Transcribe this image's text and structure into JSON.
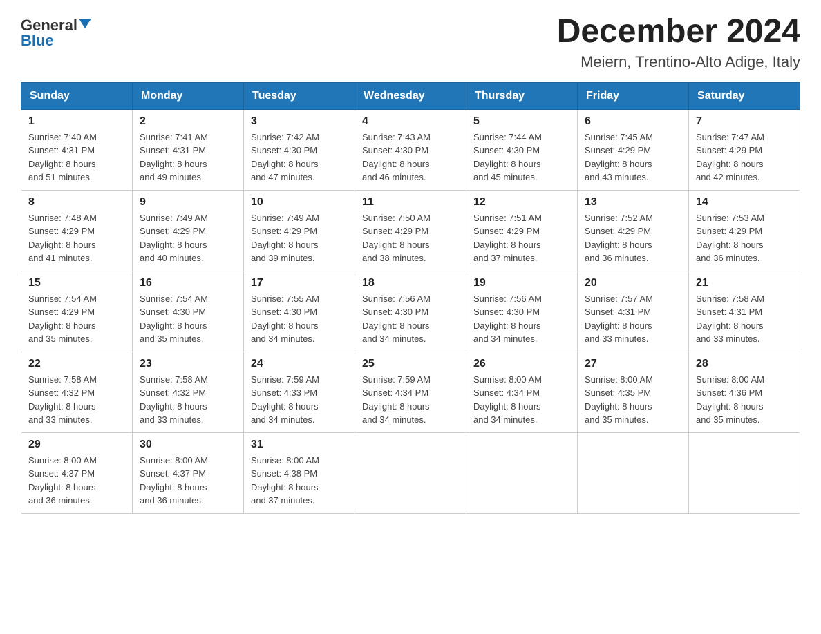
{
  "logo": {
    "general": "General",
    "blue": "Blue"
  },
  "title": "December 2024",
  "subtitle": "Meiern, Trentino-Alto Adige, Italy",
  "headers": [
    "Sunday",
    "Monday",
    "Tuesday",
    "Wednesday",
    "Thursday",
    "Friday",
    "Saturday"
  ],
  "weeks": [
    [
      {
        "num": "1",
        "sunrise": "7:40 AM",
        "sunset": "4:31 PM",
        "daylight": "8 hours and 51 minutes."
      },
      {
        "num": "2",
        "sunrise": "7:41 AM",
        "sunset": "4:31 PM",
        "daylight": "8 hours and 49 minutes."
      },
      {
        "num": "3",
        "sunrise": "7:42 AM",
        "sunset": "4:30 PM",
        "daylight": "8 hours and 47 minutes."
      },
      {
        "num": "4",
        "sunrise": "7:43 AM",
        "sunset": "4:30 PM",
        "daylight": "8 hours and 46 minutes."
      },
      {
        "num": "5",
        "sunrise": "7:44 AM",
        "sunset": "4:30 PM",
        "daylight": "8 hours and 45 minutes."
      },
      {
        "num": "6",
        "sunrise": "7:45 AM",
        "sunset": "4:29 PM",
        "daylight": "8 hours and 43 minutes."
      },
      {
        "num": "7",
        "sunrise": "7:47 AM",
        "sunset": "4:29 PM",
        "daylight": "8 hours and 42 minutes."
      }
    ],
    [
      {
        "num": "8",
        "sunrise": "7:48 AM",
        "sunset": "4:29 PM",
        "daylight": "8 hours and 41 minutes."
      },
      {
        "num": "9",
        "sunrise": "7:49 AM",
        "sunset": "4:29 PM",
        "daylight": "8 hours and 40 minutes."
      },
      {
        "num": "10",
        "sunrise": "7:49 AM",
        "sunset": "4:29 PM",
        "daylight": "8 hours and 39 minutes."
      },
      {
        "num": "11",
        "sunrise": "7:50 AM",
        "sunset": "4:29 PM",
        "daylight": "8 hours and 38 minutes."
      },
      {
        "num": "12",
        "sunrise": "7:51 AM",
        "sunset": "4:29 PM",
        "daylight": "8 hours and 37 minutes."
      },
      {
        "num": "13",
        "sunrise": "7:52 AM",
        "sunset": "4:29 PM",
        "daylight": "8 hours and 36 minutes."
      },
      {
        "num": "14",
        "sunrise": "7:53 AM",
        "sunset": "4:29 PM",
        "daylight": "8 hours and 36 minutes."
      }
    ],
    [
      {
        "num": "15",
        "sunrise": "7:54 AM",
        "sunset": "4:29 PM",
        "daylight": "8 hours and 35 minutes."
      },
      {
        "num": "16",
        "sunrise": "7:54 AM",
        "sunset": "4:30 PM",
        "daylight": "8 hours and 35 minutes."
      },
      {
        "num": "17",
        "sunrise": "7:55 AM",
        "sunset": "4:30 PM",
        "daylight": "8 hours and 34 minutes."
      },
      {
        "num": "18",
        "sunrise": "7:56 AM",
        "sunset": "4:30 PM",
        "daylight": "8 hours and 34 minutes."
      },
      {
        "num": "19",
        "sunrise": "7:56 AM",
        "sunset": "4:30 PM",
        "daylight": "8 hours and 34 minutes."
      },
      {
        "num": "20",
        "sunrise": "7:57 AM",
        "sunset": "4:31 PM",
        "daylight": "8 hours and 33 minutes."
      },
      {
        "num": "21",
        "sunrise": "7:58 AM",
        "sunset": "4:31 PM",
        "daylight": "8 hours and 33 minutes."
      }
    ],
    [
      {
        "num": "22",
        "sunrise": "7:58 AM",
        "sunset": "4:32 PM",
        "daylight": "8 hours and 33 minutes."
      },
      {
        "num": "23",
        "sunrise": "7:58 AM",
        "sunset": "4:32 PM",
        "daylight": "8 hours and 33 minutes."
      },
      {
        "num": "24",
        "sunrise": "7:59 AM",
        "sunset": "4:33 PM",
        "daylight": "8 hours and 34 minutes."
      },
      {
        "num": "25",
        "sunrise": "7:59 AM",
        "sunset": "4:34 PM",
        "daylight": "8 hours and 34 minutes."
      },
      {
        "num": "26",
        "sunrise": "8:00 AM",
        "sunset": "4:34 PM",
        "daylight": "8 hours and 34 minutes."
      },
      {
        "num": "27",
        "sunrise": "8:00 AM",
        "sunset": "4:35 PM",
        "daylight": "8 hours and 35 minutes."
      },
      {
        "num": "28",
        "sunrise": "8:00 AM",
        "sunset": "4:36 PM",
        "daylight": "8 hours and 35 minutes."
      }
    ],
    [
      {
        "num": "29",
        "sunrise": "8:00 AM",
        "sunset": "4:37 PM",
        "daylight": "8 hours and 36 minutes."
      },
      {
        "num": "30",
        "sunrise": "8:00 AM",
        "sunset": "4:37 PM",
        "daylight": "8 hours and 36 minutes."
      },
      {
        "num": "31",
        "sunrise": "8:00 AM",
        "sunset": "4:38 PM",
        "daylight": "8 hours and 37 minutes."
      },
      null,
      null,
      null,
      null
    ]
  ]
}
